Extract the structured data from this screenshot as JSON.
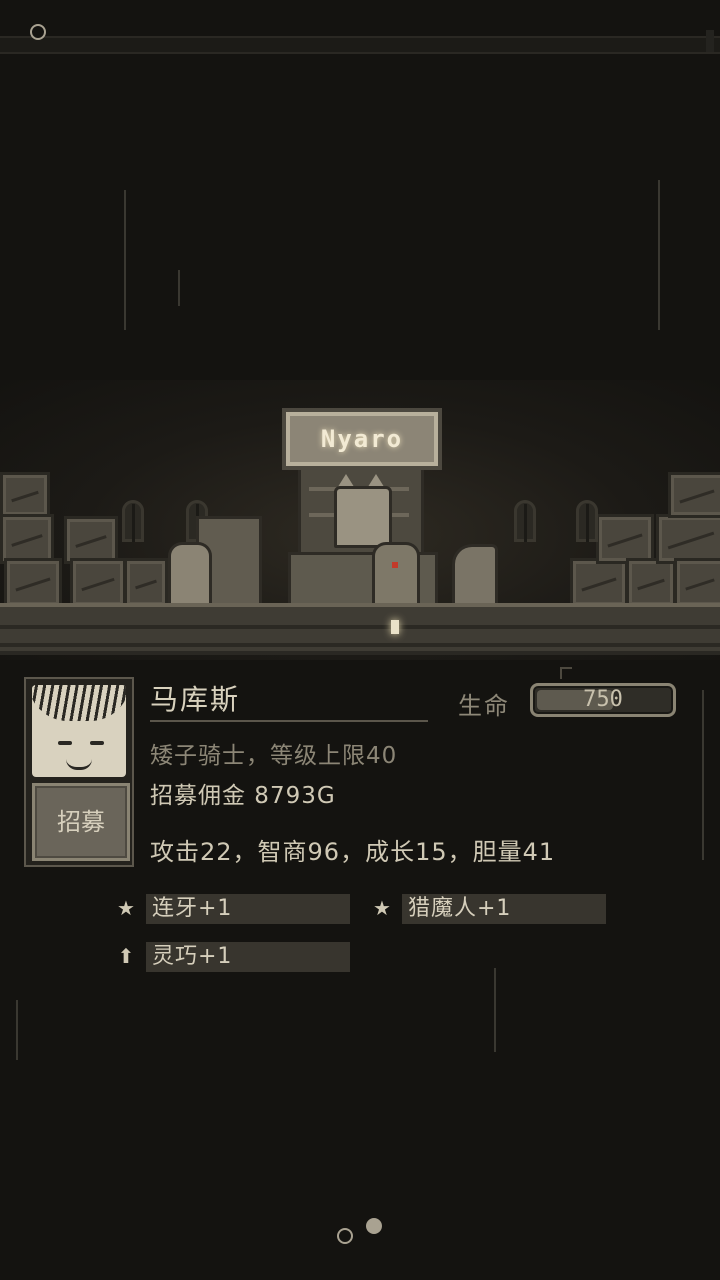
{
  "scene": {
    "sign_text": "Nyaro"
  },
  "hero": {
    "name": "马库斯",
    "hp_label": "生命",
    "hp_value": "750",
    "hp_fraction": 0.6,
    "class_line": "矮子骑士，等级上限40",
    "fee_line": "招募佣金 8793G",
    "stats_line": "攻击22，智商96，成长15，胆量41",
    "recruit_label": "招募"
  },
  "skills": [
    {
      "icon": "star-icon",
      "glyph": "★",
      "label": "连牙+1"
    },
    {
      "icon": "star-icon",
      "glyph": "★",
      "label": "猎魔人+1"
    },
    {
      "icon": "arrow-up-icon",
      "glyph": "⬆",
      "label": "灵巧+1"
    }
  ],
  "pager": {
    "total": 2,
    "current": 2
  },
  "colors": {
    "background": "#141310",
    "text": "#c9c2ae",
    "muted": "#8c8676",
    "panel": "#38352e"
  }
}
